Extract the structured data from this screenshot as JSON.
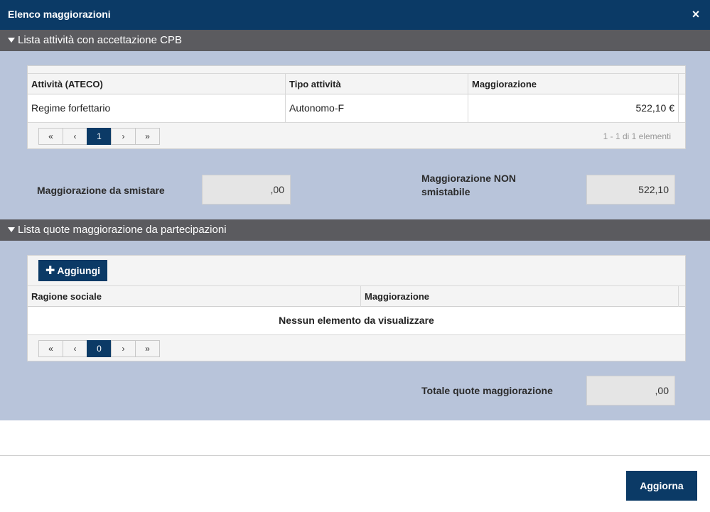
{
  "dialog": {
    "title": "Elenco maggiorazioni",
    "close_icon": "×"
  },
  "section1": {
    "title": "Lista attività con accettazione CPB",
    "columns": [
      "Attività (ATECO)",
      "Tipo attività",
      "Maggiorazione"
    ],
    "rows": [
      {
        "attivita": "Regime forfettario",
        "tipo": "Autonomo-F",
        "maggiorazione": "522,10 €"
      }
    ],
    "pager": {
      "first": "«",
      "prev": "‹",
      "page": "1",
      "next": "›",
      "last": "»",
      "info": "1 - 1 di 1 elementi"
    },
    "fields": {
      "da_smistare_label": "Maggiorazione da smistare",
      "da_smistare_value": ",00",
      "non_smistabile_label_line1": "Maggiorazione NON",
      "non_smistabile_label_line2": "smistabile",
      "non_smistabile_value": "522,10"
    }
  },
  "section2": {
    "title": "Lista quote maggiorazione da partecipazioni",
    "add_button": "Aggiungi",
    "columns": [
      "Ragione sociale",
      "Maggiorazione"
    ],
    "empty_message": "Nessun elemento da visualizzare",
    "pager": {
      "first": "«",
      "prev": "‹",
      "page": "0",
      "next": "›",
      "last": "»"
    },
    "totale_label": "Totale quote maggiorazione",
    "totale_value": ",00"
  },
  "footer": {
    "update_button": "Aggiorna"
  }
}
